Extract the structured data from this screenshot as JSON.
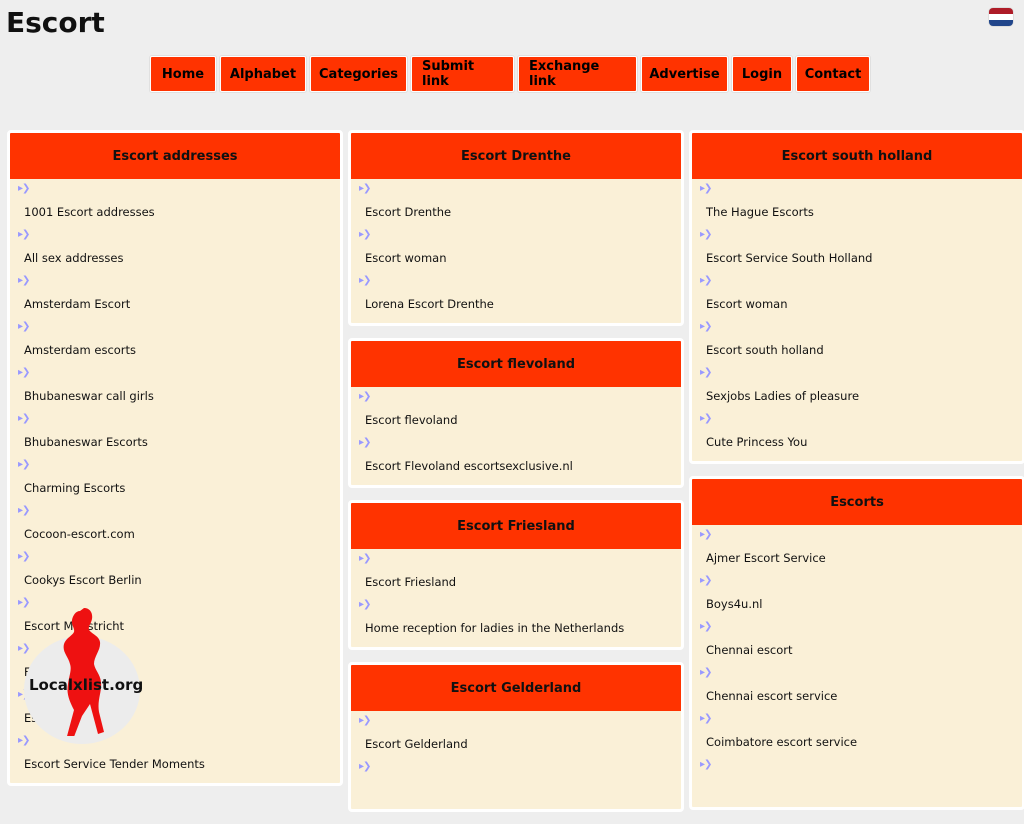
{
  "site": {
    "title": "Escort"
  },
  "nav": [
    {
      "label": "Home"
    },
    {
      "label": "Alphabet"
    },
    {
      "label": "Categories"
    },
    {
      "label": "Submit link"
    },
    {
      "label": "Exchange link"
    },
    {
      "label": "Advertise"
    },
    {
      "label": "Login"
    },
    {
      "label": "Contact"
    }
  ],
  "columns": [
    {
      "boxes": [
        {
          "title": "Escort addresses",
          "links": [
            "1001 Escort addresses",
            "All sex addresses",
            "Amsterdam Escort",
            "Amsterdam escorts",
            "Bhubaneswar call girls",
            "Bhubaneswar Escorts",
            "Charming Escorts",
            "Cocoon-escort.com",
            "Cookys Escort Berlin",
            "Escort Maastricht",
            "Escort addresses",
            "Escort",
            "Escort Service Tender Moments"
          ]
        }
      ]
    },
    {
      "boxes": [
        {
          "title": "Escort Drenthe",
          "links": [
            "Escort Drenthe",
            "Escort woman",
            "Lorena Escort Drenthe"
          ]
        },
        {
          "title": "Escort flevoland",
          "links": [
            "Escort flevoland",
            "Escort Flevoland escortsexclusive.nl"
          ]
        },
        {
          "title": "Escort Friesland",
          "links": [
            "Escort Friesland",
            "Home reception for ladies in the Netherlands"
          ]
        },
        {
          "title": "Escort Gelderland",
          "links": [
            "Escort Gelderland",
            ""
          ]
        }
      ]
    },
    {
      "boxes": [
        {
          "title": "Escort south holland",
          "links": [
            "The Hague Escorts",
            "Escort Service South Holland",
            "Escort woman",
            "Escort south holland",
            "Sexjobs Ladies of pleasure",
            "Cute Princess You"
          ]
        },
        {
          "title": "Escorts",
          "links": [
            "Ajmer Escort Service",
            "Boys4u.nl",
            "Chennai escort",
            "Chennai escort service",
            "Coimbatore escort service",
            ""
          ]
        }
      ]
    }
  ],
  "watermark": {
    "text": "Localxlist.org"
  },
  "colors": {
    "accent": "#ff3300",
    "box_bg": "#faf0d7",
    "arrow": "#9999ff",
    "page_bg": "#eeeeee"
  },
  "icons": {
    "flag": "netherlands-flag-icon",
    "arrow": "double-chevron-right-icon"
  }
}
